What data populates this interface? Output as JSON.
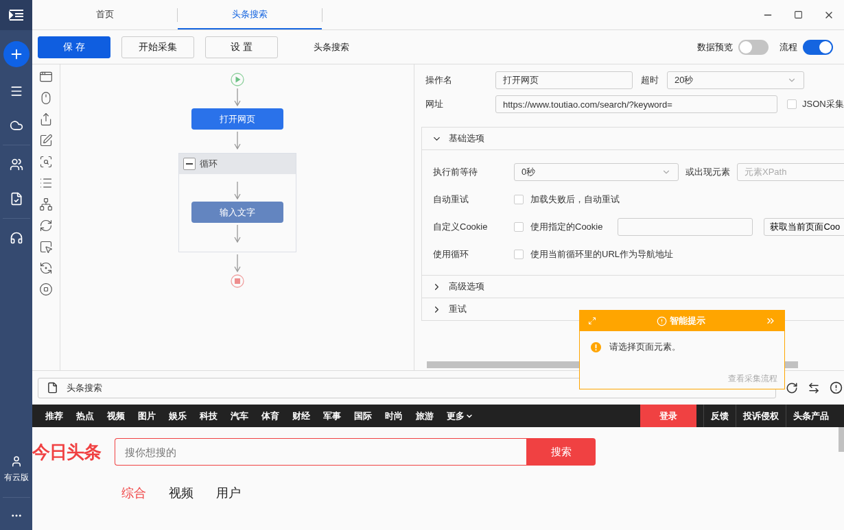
{
  "sidebar": {
    "label": "有云版"
  },
  "tabs": [
    {
      "label": "首页",
      "selected": false
    },
    {
      "label": "头条搜索",
      "selected": true
    }
  ],
  "toolbar": {
    "buttons": [
      {
        "label": "保 存",
        "kind": "primary"
      },
      {
        "label": "开始采集",
        "kind": "default"
      },
      {
        "label": "设 置",
        "kind": "default"
      }
    ],
    "title": "头条搜索",
    "toggles": [
      {
        "label": "数据预览",
        "on": false
      },
      {
        "label": "流程",
        "on": true
      }
    ]
  },
  "flow": {
    "nodes": [
      {
        "kind": "action",
        "label": "打开网页",
        "selected": true
      },
      {
        "kind": "loop",
        "label": "循环",
        "expanded": true,
        "children": [
          {
            "kind": "action",
            "label": "输入文字",
            "selected": false
          }
        ]
      }
    ]
  },
  "properties": {
    "name_label": "操作名",
    "name_value": "打开网页",
    "timeout_label": "超时",
    "timeout_value": "20秒",
    "url_label": "网址",
    "url_value": "https://www.toutiao.com/search/?keyword=",
    "json_label": "JSON采集",
    "json_checked": false,
    "sections": [
      {
        "title": "基础选项",
        "expanded": true,
        "rows": [
          {
            "kind": "select",
            "label": "执行前等待",
            "value": "0秒",
            "extra_label": "或出现元素",
            "placeholder": "元素XPath"
          },
          {
            "kind": "checkbox",
            "label": "自动重试",
            "text": "加载失败后，自动重试",
            "checked": false
          },
          {
            "kind": "cookie",
            "label": "自定义Cookie",
            "text": "使用指定的Cookie",
            "checked": false,
            "button": "获取当前页面Coo"
          },
          {
            "kind": "checkbox",
            "label": "使用循环",
            "text": "使用当前循环里的URL作为导航地址",
            "checked": false
          }
        ]
      },
      {
        "title": "高级选项",
        "expanded": false
      },
      {
        "title": "重试",
        "expanded": false
      }
    ]
  },
  "popup": {
    "title": "智能提示",
    "message": "请选择页面元素。",
    "link": "查看采集流程"
  },
  "address_bar": {
    "value": "头条搜索"
  },
  "browser": {
    "nav": [
      "推荐",
      "热点",
      "视频",
      "图片",
      "娱乐",
      "科技",
      "汽车",
      "体育",
      "财经",
      "军事",
      "国际",
      "时尚",
      "旅游"
    ],
    "more": "更多",
    "login": "登录",
    "right_links": [
      "反馈",
      "投诉侵权",
      "头条产品"
    ],
    "logo": "今日头条",
    "search_placeholder": "搜你想搜的",
    "search_button": "搜索",
    "tabs": [
      {
        "label": "综合",
        "selected": true
      },
      {
        "label": "视频",
        "selected": false
      },
      {
        "label": "用户",
        "selected": false
      }
    ]
  }
}
